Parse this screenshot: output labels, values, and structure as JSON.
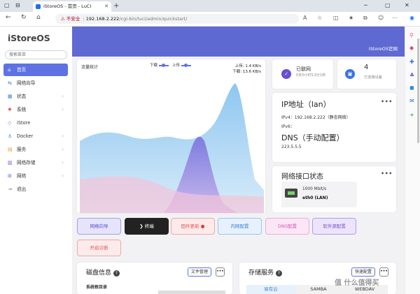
{
  "browser": {
    "tab_title": "iStoreOS - 首页 - LuCI",
    "address_warning": "⚠ 不安全",
    "address_host": "192.168.2.222",
    "address_path": "/cgi-bin/luci/admin/quickstart/"
  },
  "sidebar": {
    "brand": "iStoreOS",
    "search_placeholder": "搜索菜单",
    "items": [
      {
        "label": "首页",
        "icon": "home-icon",
        "active": true,
        "arrow": false
      },
      {
        "label": "网络向导",
        "icon": "wizard-icon",
        "active": false,
        "arrow": false
      },
      {
        "label": "状态",
        "icon": "status-icon",
        "active": false,
        "arrow": true
      },
      {
        "label": "系统",
        "icon": "system-icon",
        "active": false,
        "arrow": true
      },
      {
        "label": "iStore",
        "icon": "istore-icon",
        "active": false,
        "arrow": false
      },
      {
        "label": "Docker",
        "icon": "docker-icon",
        "active": false,
        "arrow": true
      },
      {
        "label": "服务",
        "icon": "services-icon",
        "active": false,
        "arrow": true
      },
      {
        "label": "网络存储",
        "icon": "storage-icon",
        "active": false,
        "arrow": true
      },
      {
        "label": "网络",
        "icon": "network-icon",
        "active": false,
        "arrow": true
      },
      {
        "label": "退出",
        "icon": "logout-icon",
        "active": false,
        "arrow": false
      }
    ]
  },
  "banner": {
    "link": "iStoreOS官网",
    "color": "#5e6ad2"
  },
  "traffic": {
    "title": "流量统计",
    "legend_down": "下载",
    "legend_up": "上传",
    "up_speed": "上传: 1.4 KB/s",
    "down_speed": "下载: 13.6 KB/s"
  },
  "status_cards": {
    "network": {
      "title": "已联网",
      "sub": "0天0小时13分1秒"
    },
    "devices": {
      "count": "4",
      "sub": "已连接设备"
    }
  },
  "ip_card": {
    "title": "IP地址（lan）",
    "ipv4_label": "IPv4：",
    "ipv4_value": "192.168.2.222",
    "ipv4_note": "（静态网络）",
    "ipv6_label": "IPv6：",
    "dns_title": "DNS（手动配置）",
    "dns_value": "223.5.5.5"
  },
  "iface_card": {
    "title": "网络接口状态",
    "speed": "1000 Mbit/s",
    "name": "eth0 (LAN)"
  },
  "quick_buttons": [
    {
      "label": "网络向导"
    },
    {
      "label": "❯ 终端"
    },
    {
      "label": "固件更新"
    },
    {
      "label": "内网配置"
    },
    {
      "label": "DNS配置"
    },
    {
      "label": "软件源配置"
    },
    {
      "label": "开启诊断"
    }
  ],
  "disk": {
    "title": "磁盘信息",
    "manage": "文件管理",
    "root_label": "系统根目录"
  },
  "storage": {
    "title": "存储服务",
    "deploy": "快速配置",
    "tabs": [
      "易有云",
      "SAMBA",
      "WEBDAV"
    ]
  },
  "watermark": "值 什么值得买",
  "colors": {
    "accent": "#5e72e4",
    "banner": "#5e6ad2"
  }
}
